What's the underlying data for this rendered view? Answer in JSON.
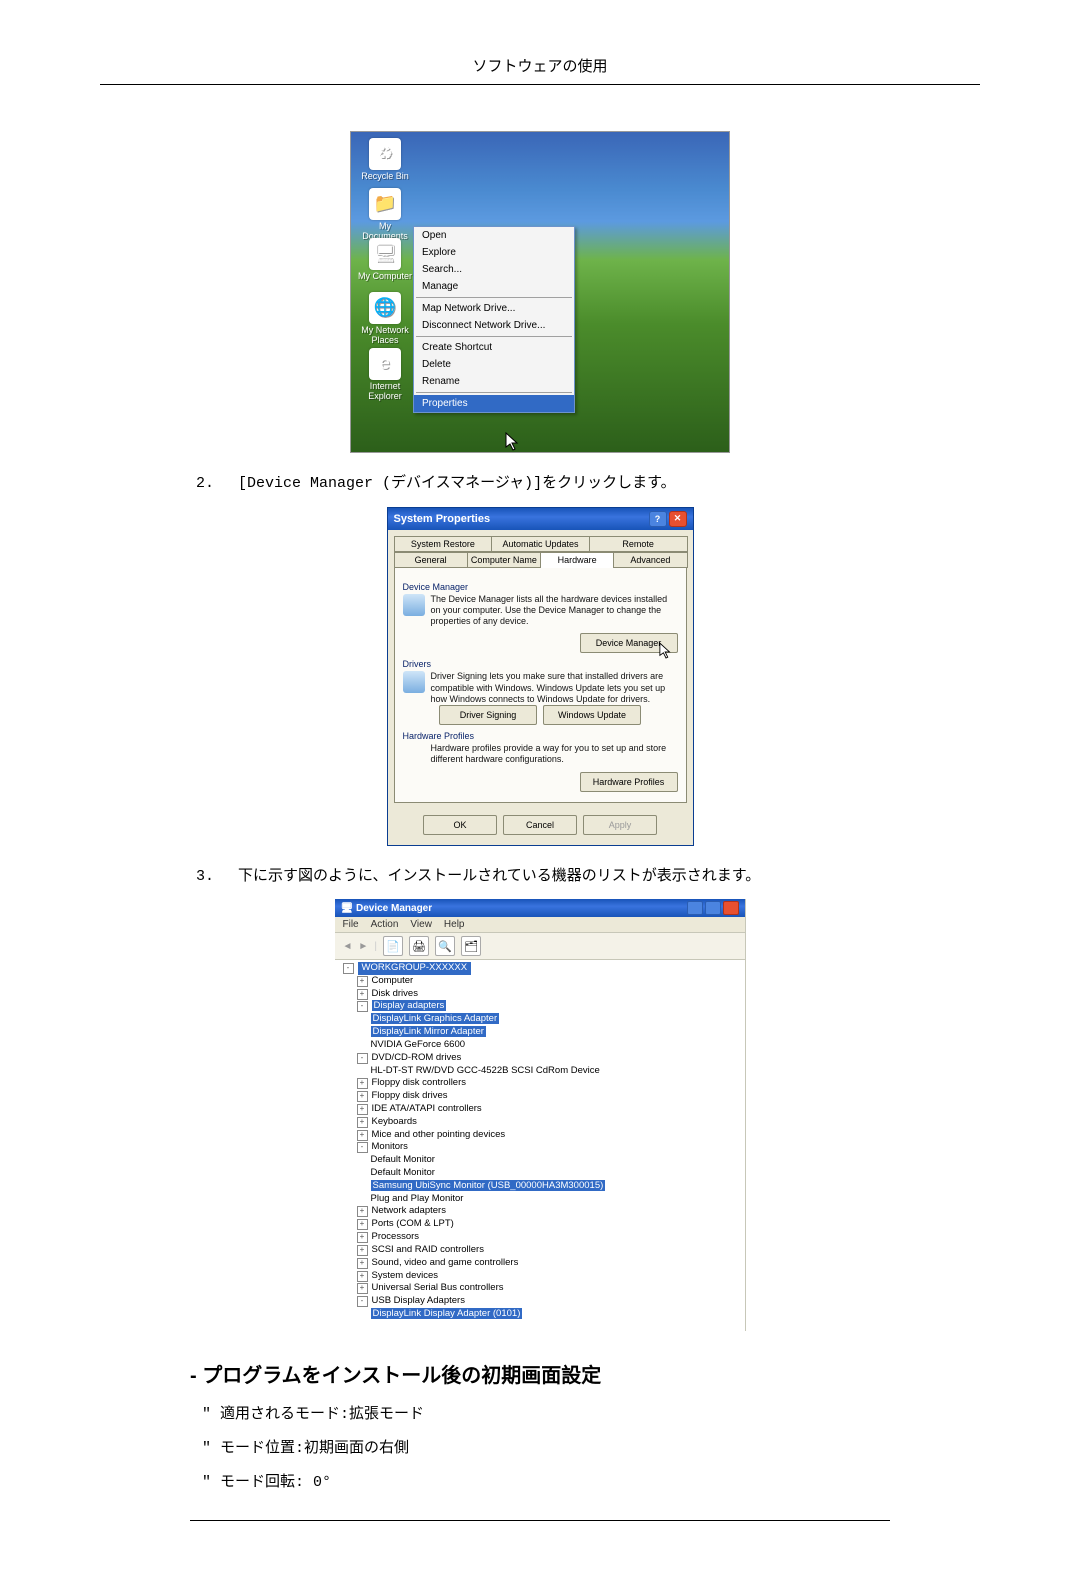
{
  "header": {
    "title": "ソフトウェアの使用"
  },
  "steps": [
    {
      "num": "2.",
      "text": "[Device Manager (デバイスマネージャ)]をクリックします。"
    },
    {
      "num": "3.",
      "text": "下に示す図のように、インストールされている機器のリストが表示されます。"
    }
  ],
  "xp_desktop": {
    "icons": {
      "recycle_bin": "Recycle Bin",
      "my_documents": "My Documents",
      "my_computer": "My Computer",
      "my_network_places": "My Network Places",
      "internet_explorer": "Internet Explorer"
    },
    "context_menu": [
      "Open",
      "Explore",
      "Search...",
      "Manage",
      "__sep__",
      "Map Network Drive...",
      "Disconnect Network Drive...",
      "__sep__",
      "Create Shortcut",
      "Delete",
      "Rename",
      "__sep__",
      "Properties"
    ],
    "highlight_index": 12
  },
  "system_properties": {
    "title": "System Properties",
    "tabs_row1": [
      "System Restore",
      "Automatic Updates",
      "Remote"
    ],
    "tabs_row2": [
      "General",
      "Computer Name",
      "Hardware",
      "Advanced"
    ],
    "active_tab": "Hardware",
    "device_manager": {
      "label": "Device Manager",
      "desc": "The Device Manager lists all the hardware devices installed on your computer. Use the Device Manager to change the properties of any device.",
      "button": "Device Manager"
    },
    "drivers": {
      "label": "Drivers",
      "desc": "Driver Signing lets you make sure that installed drivers are compatible with Windows. Windows Update lets you set up how Windows connects to Windows Update for drivers.",
      "button1": "Driver Signing",
      "button2": "Windows Update"
    },
    "hardware_profiles": {
      "label": "Hardware Profiles",
      "desc": "Hardware profiles provide a way for you to set up and store different hardware configurations.",
      "button": "Hardware Profiles"
    },
    "ok": "OK",
    "cancel": "Cancel",
    "apply": "Apply"
  },
  "device_manager_window": {
    "title": "Device Manager",
    "menu": [
      "File",
      "Action",
      "View",
      "Help"
    ],
    "root": "WORKGROUP-XXXXXX",
    "nodes": [
      {
        "label": "Computer",
        "collapsed": true
      },
      {
        "label": "Disk drives",
        "collapsed": true
      },
      {
        "label": "Display adapters",
        "selected": true,
        "children": [
          {
            "label": "DisplayLink Graphics Adapter",
            "selected": true
          },
          {
            "label": "DisplayLink Mirror Adapter",
            "selected": true
          },
          {
            "label": "NVIDIA GeForce 6600"
          }
        ]
      },
      {
        "label": "DVD/CD-ROM drives",
        "children": [
          {
            "label": "HL-DT-ST RW/DVD GCC-4522B SCSI CdRom Device"
          }
        ]
      },
      {
        "label": "Floppy disk controllers",
        "collapsed": true
      },
      {
        "label": "Floppy disk drives",
        "collapsed": true
      },
      {
        "label": "IDE ATA/ATAPI controllers",
        "collapsed": true
      },
      {
        "label": "Keyboards",
        "collapsed": true
      },
      {
        "label": "Mice and other pointing devices",
        "collapsed": true
      },
      {
        "label": "Monitors",
        "children": [
          {
            "label": "Default Monitor"
          },
          {
            "label": "Default Monitor"
          },
          {
            "label": "Samsung UbiSync Monitor (USB_00000HA3M300015)",
            "highlight": true
          },
          {
            "label": "Plug and Play Monitor"
          }
        ]
      },
      {
        "label": "Network adapters",
        "collapsed": true
      },
      {
        "label": "Ports (COM & LPT)",
        "collapsed": true
      },
      {
        "label": "Processors",
        "collapsed": true
      },
      {
        "label": "SCSI and RAID controllers",
        "collapsed": true
      },
      {
        "label": "Sound, video and game controllers",
        "collapsed": true
      },
      {
        "label": "System devices",
        "collapsed": true
      },
      {
        "label": "Universal Serial Bus controllers",
        "collapsed": true
      },
      {
        "label": "USB Display Adapters",
        "children": [
          {
            "label": "DisplayLink Display Adapter (0101)",
            "highlight": true
          }
        ]
      }
    ]
  },
  "section": {
    "heading_prefix": "- ",
    "heading": "プログラムをインストール後の初期画面設定",
    "bullets": [
      "適用されるモード:拡張モード",
      "モード位置:初期画面の右側",
      "モード回転: 0°"
    ],
    "bullet_marker": "\""
  }
}
